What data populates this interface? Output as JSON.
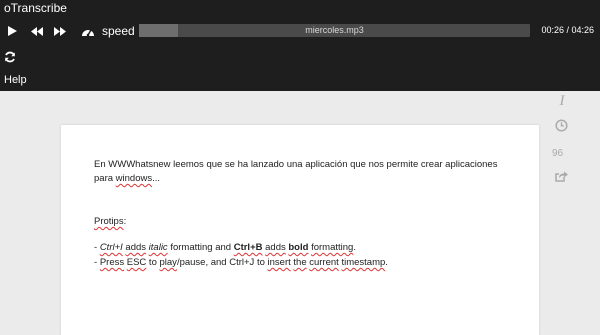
{
  "app": {
    "title": "oTranscribe"
  },
  "controls": {
    "play_icon": "play-icon",
    "rewind_icon": "rewind-icon",
    "forward_icon": "fast-forward-icon",
    "speed_icon": "speedometer-icon",
    "speed_label": "speed",
    "sync_icon": "refresh-icon"
  },
  "player": {
    "filename": "miercoles.mp3",
    "current_time": "00:26",
    "duration": "04:26",
    "time_display": "00:26 / 04:26",
    "progress_fraction": 0.1
  },
  "menu": {
    "help_label": "Help"
  },
  "sidebar": {
    "italic_glyph": "I",
    "clock_icon": "clock-icon",
    "word_count": "96",
    "export_icon": "export-icon"
  },
  "document": {
    "para1_a": "En WWWhatsnew leemos que se ha lanzado una aplicación que nos permite crear aplicaciones para ",
    "para1_link": "windows",
    "para1_end": "...",
    "protips": "Protips",
    "protips_colon": ":",
    "tip1": {
      "dash": "- ",
      "ctrl_i": "Ctrl+I",
      "t1": " ",
      "adds": "adds",
      "t2": " ",
      "italic": "italic",
      "t3": " formatting and ",
      "ctrl_b": "Ctrl+B",
      "t4": " ",
      "adds2": "adds",
      "t5": " ",
      "bold": "bold",
      "t6": " ",
      "formatting": "formatting",
      "t7": "."
    },
    "tip2": {
      "dash": "- ",
      "press": "Press",
      "t1": " ",
      "esc": "ESC",
      "t2": " to ",
      "play": "play",
      "t3": "/pause, and Ctrl+J to ",
      "insert": "insert",
      "t4": " ",
      "the": "the",
      "t5": " ",
      "current": "current",
      "t6": " ",
      "timestamp": "timestamp",
      "t7": "."
    }
  },
  "colors": {
    "topbar_bg": "#1e1e1e",
    "progress_bg": "#4a4a4a",
    "page_bg": "#ebebeb",
    "spellcheck": "#dd3333"
  }
}
